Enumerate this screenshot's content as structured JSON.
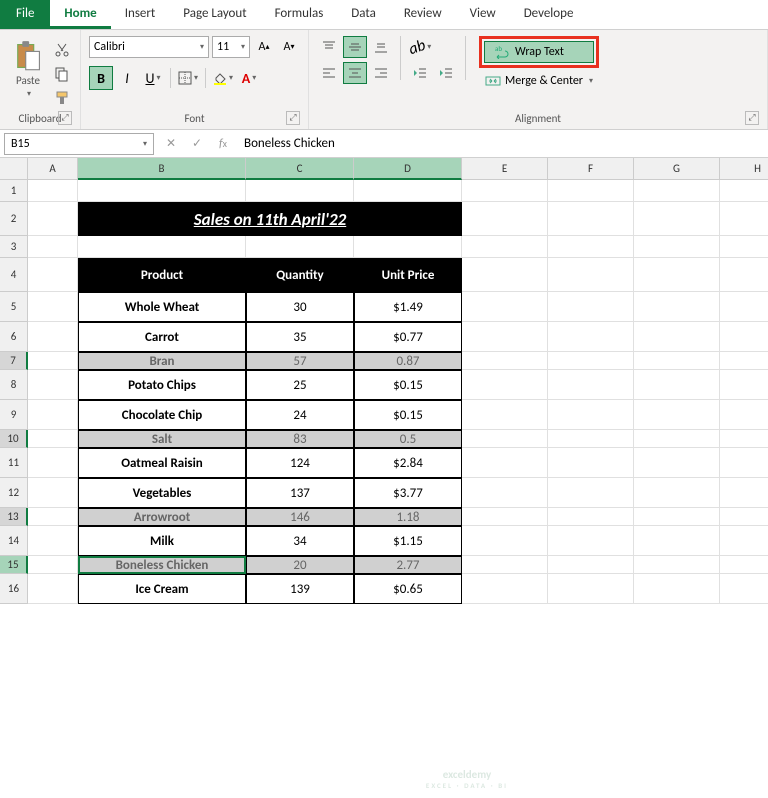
{
  "tabs": {
    "file": "File",
    "items": [
      "Home",
      "Insert",
      "Page Layout",
      "Formulas",
      "Data",
      "Review",
      "View",
      "Develope"
    ]
  },
  "ribbon": {
    "clipboard": {
      "label": "Clipboard",
      "paste": "Paste"
    },
    "font": {
      "label": "Font",
      "name": "Calibri",
      "size": "11",
      "bold": "B",
      "italic": "I",
      "underline": "U"
    },
    "alignment": {
      "label": "Alignment",
      "wrap": "Wrap Text",
      "merge": "Merge & Center"
    }
  },
  "formula_bar": {
    "name_box": "B15",
    "formula": "Boneless Chicken"
  },
  "columns": [
    "A",
    "B",
    "C",
    "D",
    "E",
    "F",
    "G",
    "H"
  ],
  "title": "Sales on 11th April'22",
  "headers": {
    "product": "Product",
    "qty": "Quantity",
    "price": "Unit Price"
  },
  "rows": [
    {
      "n": "1",
      "h": "h22"
    },
    {
      "n": "2",
      "h": "h34",
      "title": true
    },
    {
      "n": "3",
      "h": "h22"
    },
    {
      "n": "4",
      "h": "h34",
      "hdr": true
    },
    {
      "n": "5",
      "h": "h30",
      "p": "Whole Wheat",
      "q": "30",
      "u": "$1.49"
    },
    {
      "n": "6",
      "h": "h30",
      "p": "Carrot",
      "q": "35",
      "u": "$0.77"
    },
    {
      "n": "7",
      "h": "h18",
      "p": "Bran",
      "q": "57",
      "u": "0.87",
      "grey": true,
      "sel": true
    },
    {
      "n": "8",
      "h": "h30",
      "p": "Potato Chips",
      "q": "25",
      "u": "$0.15"
    },
    {
      "n": "9",
      "h": "h30",
      "p": "Chocolate Chip",
      "q": "24",
      "u": "$0.15"
    },
    {
      "n": "10",
      "h": "h18",
      "p": "Salt",
      "q": "83",
      "u": "0.5",
      "grey": true,
      "sel": true
    },
    {
      "n": "11",
      "h": "h30",
      "p": "Oatmeal Raisin",
      "q": "124",
      "u": "$2.84"
    },
    {
      "n": "12",
      "h": "h30",
      "p": "Vegetables",
      "q": "137",
      "u": "$3.77"
    },
    {
      "n": "13",
      "h": "h18",
      "p": "Arrowroot",
      "q": "146",
      "u": "1.18",
      "grey": true,
      "sel": true
    },
    {
      "n": "14",
      "h": "h30",
      "p": "Milk",
      "q": "34",
      "u": "$1.15"
    },
    {
      "n": "15",
      "h": "h18",
      "p": "Boneless Chicken",
      "q": "20",
      "u": "2.77",
      "grey": true,
      "sel": true,
      "active": true
    },
    {
      "n": "16",
      "h": "h30",
      "p": "Ice Cream",
      "q": "139",
      "u": "$0.65"
    }
  ],
  "watermark": {
    "main": "exceldemy",
    "sub": "EXCEL · DATA · BI"
  }
}
